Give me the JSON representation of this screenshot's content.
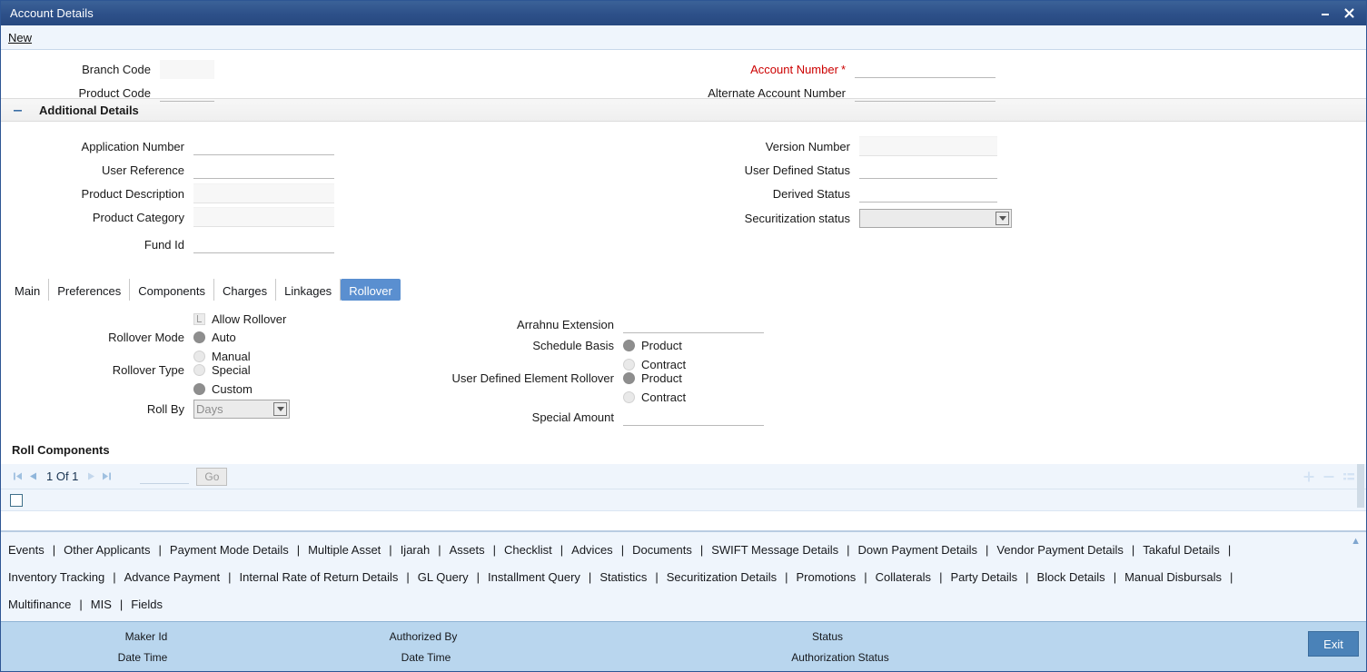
{
  "window": {
    "title": "Account Details",
    "minimize_icon": "minimize-icon",
    "close_icon": "close-icon"
  },
  "menu": {
    "items": [
      {
        "label": "New"
      }
    ]
  },
  "header_form": {
    "left": [
      {
        "label": "Branch Code",
        "value": "",
        "readonly": true
      },
      {
        "label": "Product Code",
        "value": "",
        "readonly": false
      }
    ],
    "right": [
      {
        "label": "Account Number",
        "value": "",
        "required": true,
        "star": "*"
      },
      {
        "label": "Alternate Account Number",
        "value": "",
        "required": false
      }
    ]
  },
  "additional_details": {
    "title": "Additional Details",
    "collapse_icon": "minus-icon",
    "left": [
      {
        "label": "Application Number",
        "value": "",
        "readonly": false
      },
      {
        "label": "User Reference",
        "value": "",
        "readonly": false
      },
      {
        "label": "Product Description",
        "value": "",
        "readonly": true
      },
      {
        "label": "Product Category",
        "value": "",
        "readonly": true
      },
      {
        "label": "Fund Id",
        "value": "",
        "readonly": false
      }
    ],
    "right": [
      {
        "label": "Version Number",
        "value": "",
        "readonly": true
      },
      {
        "label": "User Defined Status",
        "value": "",
        "readonly": false
      },
      {
        "label": "Derived Status",
        "value": "",
        "readonly": false
      }
    ],
    "securitization": {
      "label": "Securitization status",
      "value": "",
      "options": [
        ""
      ]
    }
  },
  "tabs": [
    {
      "label": "Main",
      "active": false
    },
    {
      "label": "Preferences",
      "active": false
    },
    {
      "label": "Components",
      "active": false
    },
    {
      "label": "Charges",
      "active": false
    },
    {
      "label": "Linkages",
      "active": false
    },
    {
      "label": "Rollover",
      "active": true
    }
  ],
  "rollover": {
    "allow_rollover": {
      "label": "Allow Rollover",
      "checked": true
    },
    "rollover_mode": {
      "label": "Rollover Mode",
      "options": [
        {
          "label": "Auto",
          "selected": true
        },
        {
          "label": "Manual",
          "selected": false
        }
      ]
    },
    "rollover_type": {
      "label": "Rollover Type",
      "options": [
        {
          "label": "Special",
          "selected": false
        },
        {
          "label": "Custom",
          "selected": true
        }
      ]
    },
    "roll_by": {
      "label": "Roll By",
      "value": "Days",
      "options": [
        "Days"
      ]
    },
    "arrahnu_extension": {
      "label": "Arrahnu Extension",
      "value": ""
    },
    "schedule_basis": {
      "label": "Schedule Basis",
      "options": [
        {
          "label": "Product",
          "selected": true
        },
        {
          "label": "Contract",
          "selected": false
        }
      ]
    },
    "ude_rollover": {
      "label": "User Defined Element Rollover",
      "options": [
        {
          "label": "Product",
          "selected": true
        },
        {
          "label": "Contract",
          "selected": false
        }
      ]
    },
    "special_amount": {
      "label": "Special Amount",
      "value": ""
    }
  },
  "roll_components": {
    "title": "Roll Components",
    "pagination": {
      "first_icon": "first-page-icon",
      "prev_icon": "prev-page-icon",
      "text": "1 Of 1",
      "next_icon": "next-page-icon",
      "last_icon": "last-page-icon",
      "goto_value": "",
      "go_label": "Go"
    },
    "actions": [
      {
        "icon": "add-row-icon",
        "glyph": "+"
      },
      {
        "icon": "remove-row-icon",
        "glyph": "−"
      },
      {
        "icon": "grid-options-icon",
        "glyph": "≡"
      }
    ],
    "select_all_checkbox": false
  },
  "links": {
    "row1": [
      "Events",
      "Other Applicants",
      "Payment Mode Details",
      "Multiple Asset",
      "Ijarah",
      "Assets",
      "Checklist",
      "Advices",
      "Documents",
      "SWIFT Message Details",
      "Down Payment Details",
      "Vendor Payment Details",
      "Takaful Details"
    ],
    "row2": [
      "Inventory Tracking",
      "Advance Payment",
      "Internal Rate of Return Details",
      "GL Query",
      "Installment Query",
      "Statistics",
      "Securitization Details",
      "Promotions",
      "Collaterals",
      "Party Details",
      "Block Details",
      "Manual Disbursals"
    ],
    "row3": [
      "Multifinance",
      "MIS",
      "Fields"
    ],
    "scroll_icon": "scroll-up-icon"
  },
  "footer": {
    "row1": [
      "Maker Id",
      "Authorized By",
      "Status"
    ],
    "row2": [
      "Date Time",
      "Date Time",
      "Authorization Status"
    ],
    "exit_label": "Exit"
  },
  "colors": {
    "titlebar": "#2d5089",
    "accent": "#5a8fd0",
    "required": "#cc0000",
    "footer": "#b9d6ee",
    "link_zone": "#eff5fc"
  }
}
